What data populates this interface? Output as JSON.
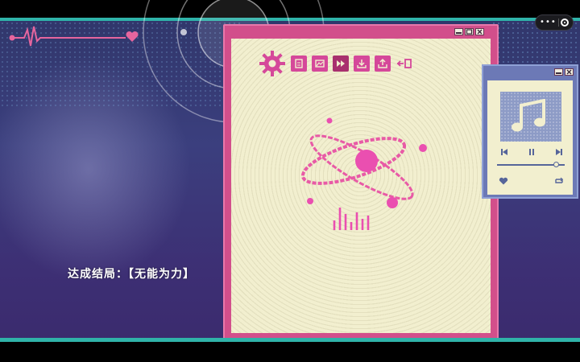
{
  "ending": {
    "text": "达成结局：【无能为力】"
  },
  "capsule": {
    "more_glyph": "•••"
  },
  "main_window": {
    "buttons": [
      "minimize",
      "restore",
      "close"
    ],
    "toolbar": [
      "gear-icon",
      "note-icon",
      "image-icon",
      "fast-forward-icon",
      "download-icon",
      "share-icon",
      "exit-icon"
    ],
    "active_tool": "fast-forward-icon"
  },
  "player": {
    "buttons": [
      "minimize",
      "close"
    ],
    "progress": 0.88
  },
  "colors": {
    "accent_pink": "#d24f8b",
    "teal_bar": "#2fb3a9",
    "paper": "#f2efcf",
    "player_blue": "#6c79b6"
  }
}
